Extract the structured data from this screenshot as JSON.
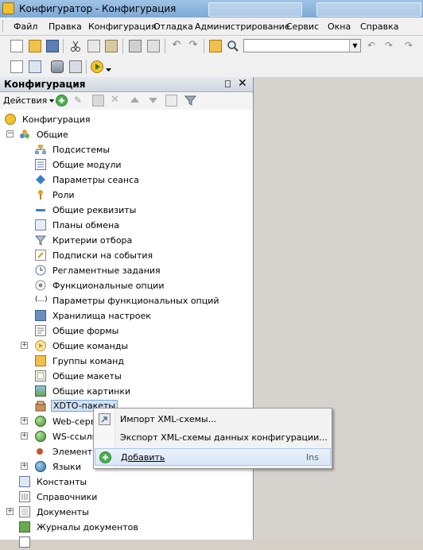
{
  "window": {
    "title": "Конфигуратор - Конфигурация"
  },
  "menubar": {
    "items": [
      "Файл",
      "Правка",
      "Конфигурация",
      "Отладка",
      "Администрирование",
      "Сервис",
      "Окна",
      "Справка"
    ]
  },
  "toolbar": {
    "search_value": "",
    "icons": [
      "new-document-icon",
      "open-folder-icon",
      "save-icon",
      "cut-icon",
      "copy-icon",
      "paste-icon",
      "print-icon",
      "preview-icon",
      "undo-icon",
      "redo-icon",
      "find-in-files-icon",
      "search-icon",
      "search-prev-icon",
      "search-next-icon",
      "replace-icon",
      "config-tree-icon",
      "metadata-icon",
      "database-icon",
      "compare-icon",
      "run-debug-icon"
    ]
  },
  "panel": {
    "title": "Конфигурация",
    "actions_label": "Действия"
  },
  "tree": {
    "root": "Конфигурация",
    "common": "Общие",
    "items": [
      "Подсистемы",
      "Общие модули",
      "Параметры сеанса",
      "Роли",
      "Общие реквизиты",
      "Планы обмена",
      "Критерии отбора",
      "Подписки на события",
      "Регламентные задания",
      "Функциональные опции",
      "Параметры функциональных опций",
      "Хранилища настроек",
      "Общие формы",
      "Общие команды",
      "Группы команд",
      "Общие макеты",
      "Общие картинки",
      "XDTO-пакеты",
      "Web-сервисы",
      "WS-ссылки",
      "Элементы стиля",
      "Языки"
    ],
    "top_items": [
      "Константы",
      "Справочники",
      "Документы",
      "Журналы документов"
    ]
  },
  "context_menu": {
    "import_label": "Импорт XML-схемы...",
    "export_label": "Экспорт XML-схемы данных конфигурации...",
    "add_label": "Добавить",
    "add_shortcut": "Ins"
  },
  "colors": {
    "selection": "#cfe3f7",
    "menu_highlight": "#d8e6f6",
    "workspace": "#d6d3ce"
  }
}
